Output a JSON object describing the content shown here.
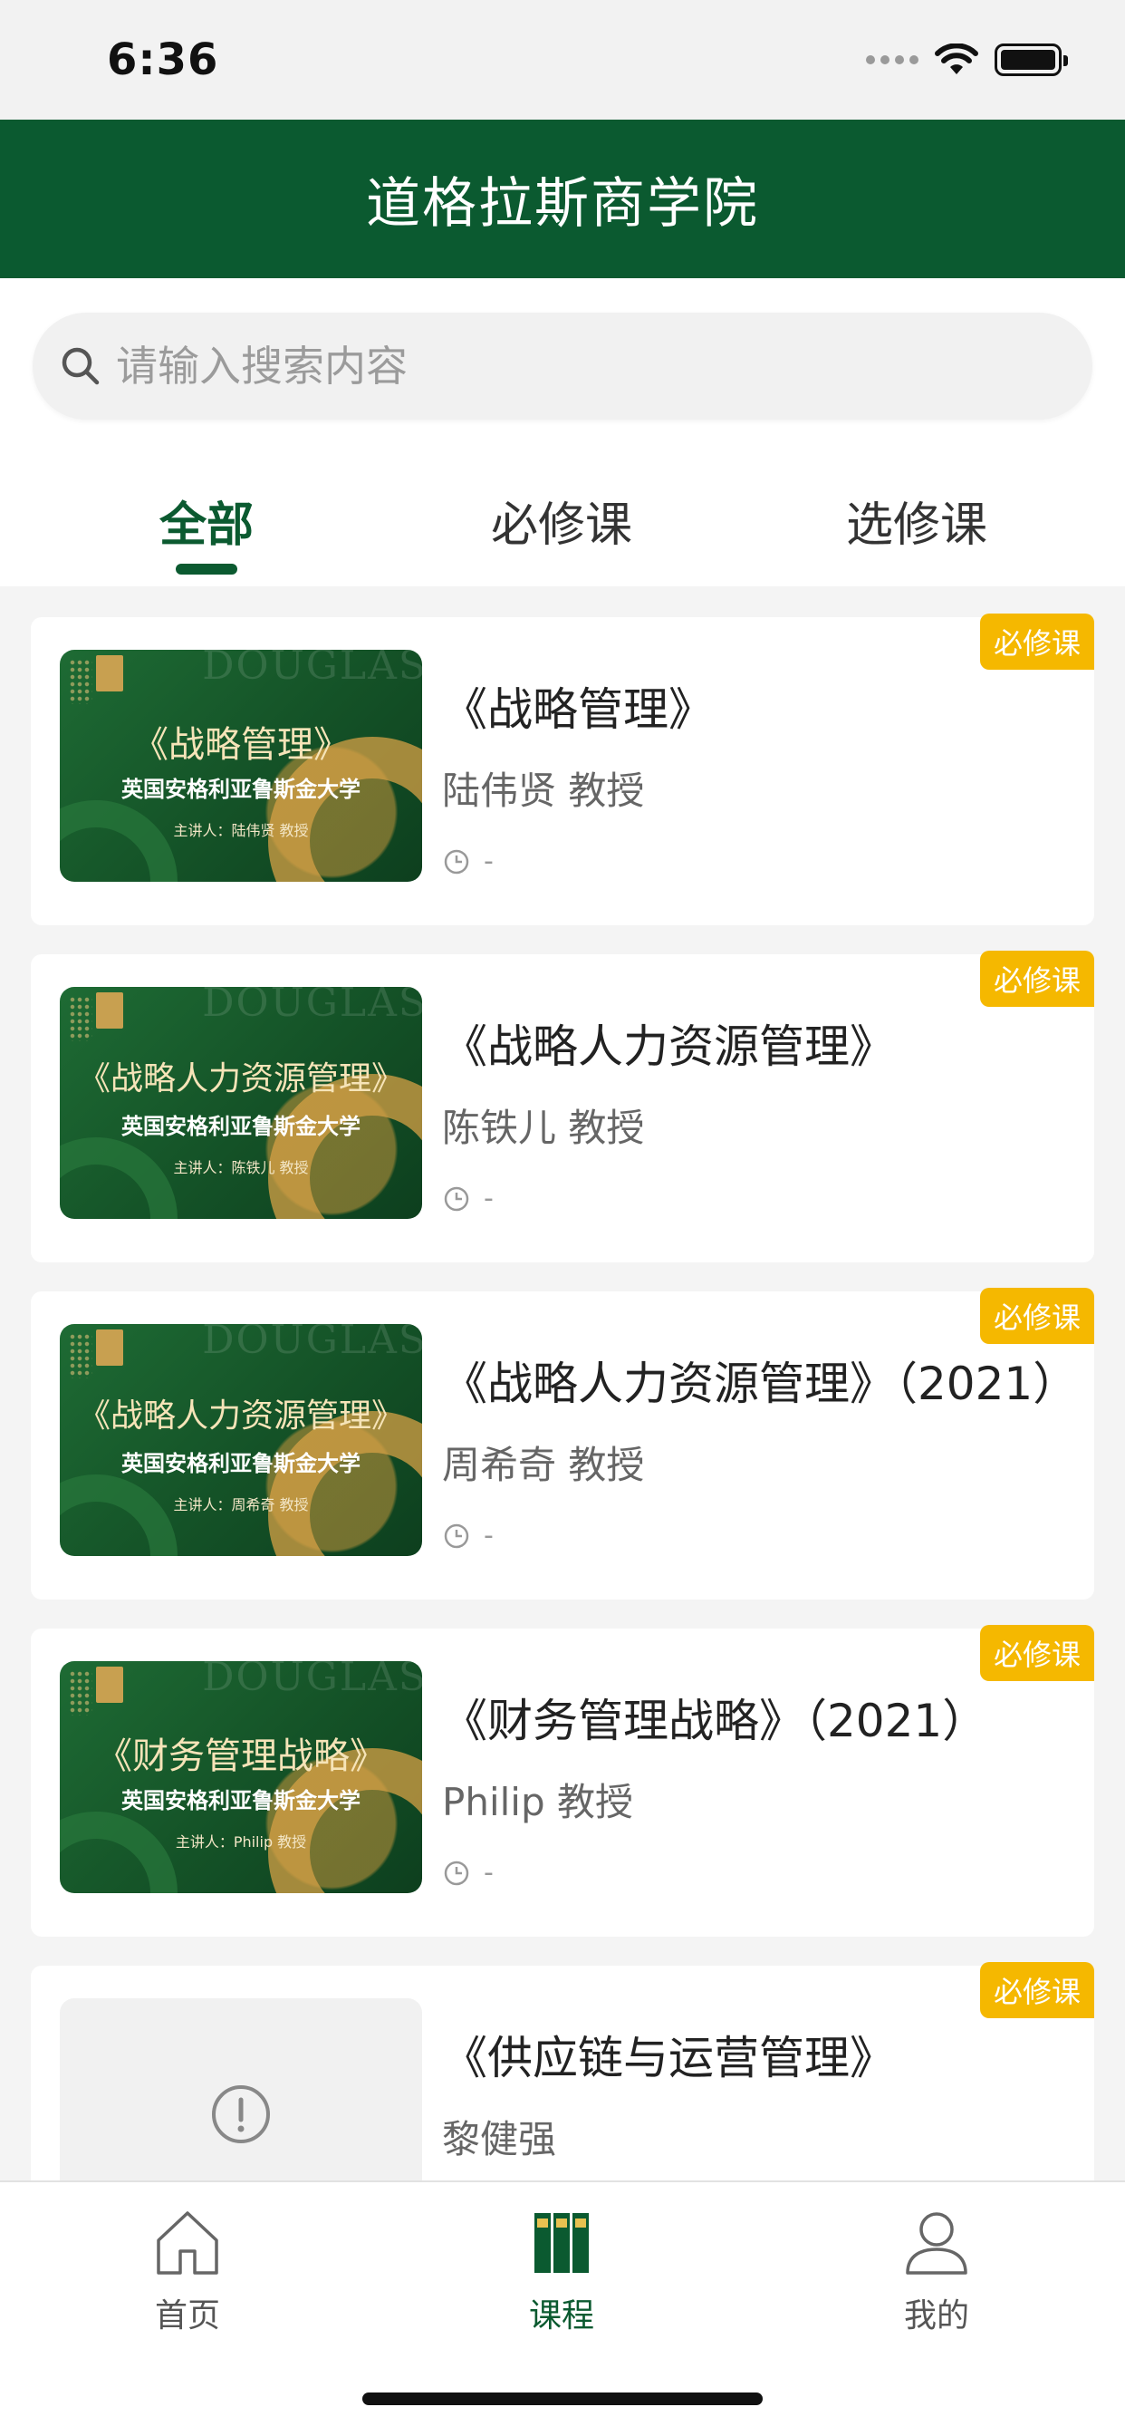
{
  "status_bar": {
    "time": "6:36",
    "signal_icon": "signal-dots-icon",
    "wifi_icon": "wifi-icon",
    "battery_icon": "battery-icon"
  },
  "header": {
    "title": "道格拉斯商学院"
  },
  "search": {
    "placeholder": "请输入搜索内容",
    "icon": "search-icon"
  },
  "tabs": [
    {
      "label": "全部",
      "active": true
    },
    {
      "label": "必修课",
      "active": false
    },
    {
      "label": "选修课",
      "active": false
    }
  ],
  "courses": [
    {
      "title": "《战略管理》",
      "teacher": "陆伟贤 教授",
      "time": "-",
      "badge": "必修课",
      "thumb": {
        "title": "《战略管理》",
        "subtitle": "英国安格利亚鲁斯金大学",
        "lecturer": "主讲人：陆伟贤 教授",
        "watermark": "DOUGLAS"
      }
    },
    {
      "title": "《战略人力资源管理》",
      "teacher": "陈铁儿 教授",
      "time": "-",
      "badge": "必修课",
      "thumb": {
        "title": "《战略人力资源管理》",
        "subtitle": "英国安格利亚鲁斯金大学",
        "lecturer": "主讲人：陈铁儿 教授",
        "watermark": "DOUGLAS"
      }
    },
    {
      "title": "《战略人力资源管理》（2021）",
      "teacher": "周希奇 教授",
      "time": "-",
      "badge": "必修课",
      "thumb": {
        "title": "《战略人力资源管理》",
        "subtitle": "英国安格利亚鲁斯金大学",
        "lecturer": "主讲人：周希奇 教授",
        "watermark": "DOUGLAS"
      }
    },
    {
      "title": "《财务管理战略》（2021）",
      "teacher": "Philip 教授",
      "time": "-",
      "badge": "必修课",
      "thumb": {
        "title": "《财务管理战略》",
        "subtitle": "英国安格利亚鲁斯金大学",
        "lecturer": "主讲人：Philip 教授",
        "watermark": "DOUGLAS"
      }
    },
    {
      "title": "《供应链与运营管理》",
      "teacher": "黎健强",
      "time": "",
      "badge": "必修课",
      "thumb": null
    }
  ],
  "tabbar": [
    {
      "label": "首页",
      "icon": "home-icon",
      "active": false
    },
    {
      "label": "课程",
      "icon": "books-icon",
      "active": true
    },
    {
      "label": "我的",
      "icon": "user-icon",
      "active": false
    }
  ],
  "colors": {
    "primary": "#0b5a30",
    "badge": "#f5b800"
  }
}
